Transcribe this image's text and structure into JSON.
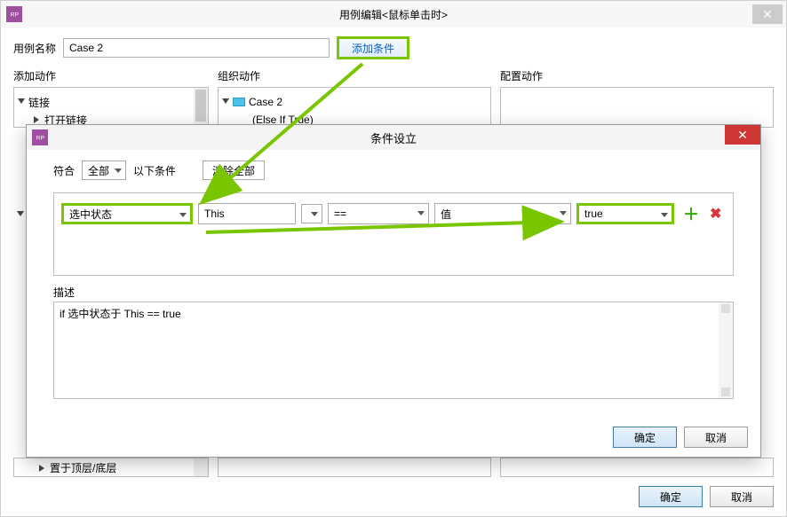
{
  "outer": {
    "title": "用例编辑<鼠标单击时>",
    "caseNameLabel": "用例名称",
    "caseNameValue": "Case 2",
    "addConditionBtn": "添加条件",
    "panels": {
      "addAction": "添加动作",
      "organize": "组织动作",
      "configure": "配置动作"
    },
    "tree": {
      "linkGroup": "链接",
      "openLink": "打开链接",
      "bottomHidden": "置于顶层/底层"
    },
    "orgCase": "Case 2",
    "orgSub": "(Else If True)",
    "ok": "确定",
    "cancel": "取消"
  },
  "cond": {
    "title": "条件设立",
    "matchLabel": "符合",
    "matchAll": "全部",
    "ofFollowing": "以下条件",
    "clearAll": "清除全部",
    "row": {
      "type": "选中状态",
      "target": "This",
      "op": "==",
      "valueKind": "值",
      "value": "true"
    },
    "descLabel": "描述",
    "descText": "if 选中状态于 This == true",
    "ok": "确定",
    "cancel": "取消"
  }
}
